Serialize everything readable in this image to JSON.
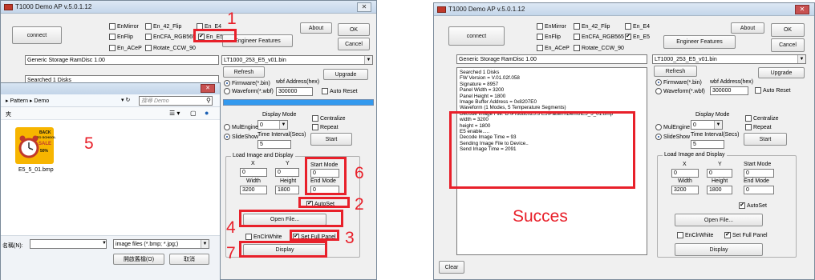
{
  "left_window": {
    "title": "T1000 Demo AP v.5.0.1.12",
    "close_glyph": "✕",
    "connect": "connect",
    "checkboxes": {
      "en_mirror": "EnMirror",
      "en_42_flip": "En_42_Flip",
      "en_e4": "En_E4",
      "en_flip": "EnFlip",
      "en_cfa_rgb565": "EnCFA_RGB565",
      "en_e5": "En_E5",
      "en_acep": "En_ACeP",
      "rotate_ccw_90": "Rotate_CCW_90"
    },
    "about": "About",
    "ok": "OK",
    "cancel": "Cancel",
    "engineer_features": "Engineer Features",
    "storage": "Generic Storage RamDisc 1.00",
    "bin_file": "LT1000_253_E5_v01.bin",
    "refresh": "Refresh",
    "upgrade": "Upgrade",
    "firmware": "Firmware(*.bin)",
    "waveform": "Waveform(*.wbf)",
    "wbf_address_label": "wbf Address(hex)",
    "wbf_address_value": "300000",
    "auto_reset": "Auto Reset",
    "searched": "Searched 1 Disks",
    "display_mode": "Display Mode",
    "display_mode_value": "0",
    "multiengine": "MulEngine",
    "slideshow": "SlideShow",
    "centralize": "Centralize",
    "repeat": "Repeat",
    "time_interval": "Time Interval(Secs)",
    "time_interval_value": "5",
    "start": "Start",
    "load_group": "Load Image and Display",
    "x": "X",
    "y": "Y",
    "x_value": "0",
    "y_value": "0",
    "start_mode": "Start Mode",
    "start_mode_value": "0",
    "width": "Width",
    "height": "Height",
    "width_value": "3200",
    "height_value": "1800",
    "end_mode": "End Mode",
    "end_mode_value": "0",
    "autoset": "AutoSet",
    "open_file": "Open File...",
    "en_clr_white": "EnClrWhite",
    "set_full_panel": "Set Full Panel",
    "display": "Display",
    "check_glyph": "✔"
  },
  "file_dialog": {
    "breadcrumb": "▸ Pattern ▸ Demo",
    "search_placeholder": "搜尋 Demo",
    "sidebar_label": "夾",
    "file_name": "E5_5_01.bmp",
    "thumb_line1": "BACK",
    "thumb_line2": "TO SCHOOL",
    "thumb_line3": "SALE",
    "thumb_line4": "50%",
    "filename_label": "名稱(N):",
    "filter": "image files (*.bmp; *.jpg;)",
    "open": "開啟舊檔(O)",
    "cancel": "取消"
  },
  "right_window": {
    "title": "T1000 Demo AP v.5.0.1.12",
    "connect": "connect",
    "checkboxes": {
      "en_mirror": "EnMirror",
      "en_42_flip": "En_42_Flip",
      "en_e4": "En_E4",
      "en_flip": "EnFlip",
      "en_cfa_rgb565": "EnCFA_RGB565",
      "en_e5": "En_E5",
      "en_acep": "En_ACeP",
      "rotate_ccw_90": "Rotate_CCW_90"
    },
    "about": "About",
    "ok": "OK",
    "cancel": "Cancel",
    "engineer_features": "Engineer Features",
    "storage": "Generic Storage RamDisc 1.00",
    "bin_file": "LT1000_253_E5_v01.bin",
    "refresh": "Refresh",
    "upgrade": "Upgrade",
    "firmware": "Firmware(*.bin)",
    "waveform": "Waveform(*.wbf)",
    "wbf_address_label": "wbf Address(hex)",
    "wbf_address_value": "300000",
    "auto_reset": "Auto Reset",
    "log_lines": [
      "Searched 1 Disks",
      "FW Version = V.01.02f.058",
      "Signature = 8957",
      "Panel Width = 3200",
      "Panel Height = 1800",
      "Image Buffer Address = 0x8207E0",
      "Waveform (1 Modes, 5 Temperature Segments)",
      "Decode Image File: D:\\Product\\25.3 E5\\Pattern\\Demo\\E5_5_01.bmp",
      "width = 3200",
      "height = 1800",
      "E5 enable.....",
      "Decode Image Time = 93",
      "Sending Image File to Device..",
      "Send Image Time = 2091"
    ],
    "display_mode": "Display Mode",
    "display_mode_value": "0",
    "multiengine": "MulEngine",
    "slideshow": "SlideShow",
    "centralize": "Centralize",
    "repeat": "Repeat",
    "time_interval": "Time Interval(Secs)",
    "time_interval_value": "5",
    "start": "Start",
    "load_group": "Load Image and Display",
    "x": "X",
    "y": "Y",
    "x_value": "0",
    "y_value": "0",
    "start_mode": "Start Mode",
    "start_mode_value": "0",
    "width": "Width",
    "height": "Height",
    "width_value": "3200",
    "height_value": "1800",
    "end_mode": "End Mode",
    "end_mode_value": "0",
    "autoset": "AutoSet",
    "open_file": "Open File...",
    "en_clr_white": "EnClrWhite",
    "set_full_panel": "Set Full Panel",
    "display": "Display",
    "clear": "Clear",
    "check_glyph": "✔"
  },
  "annotations": {
    "step1": "1",
    "step2": "2",
    "step3": "3",
    "step4": "4",
    "step5": "5",
    "step6": "6",
    "step7": "7",
    "result": "Succes"
  },
  "colors": {
    "highlight": "#e8202a",
    "progress": "#3399ee"
  },
  "icons": [
    "app-icon",
    "close-icon",
    "folder-back-icon",
    "refresh-icon",
    "search-icon",
    "view-icon",
    "help-icon",
    "alarm-clock-icon",
    "dropdown-arrow-icon"
  ]
}
